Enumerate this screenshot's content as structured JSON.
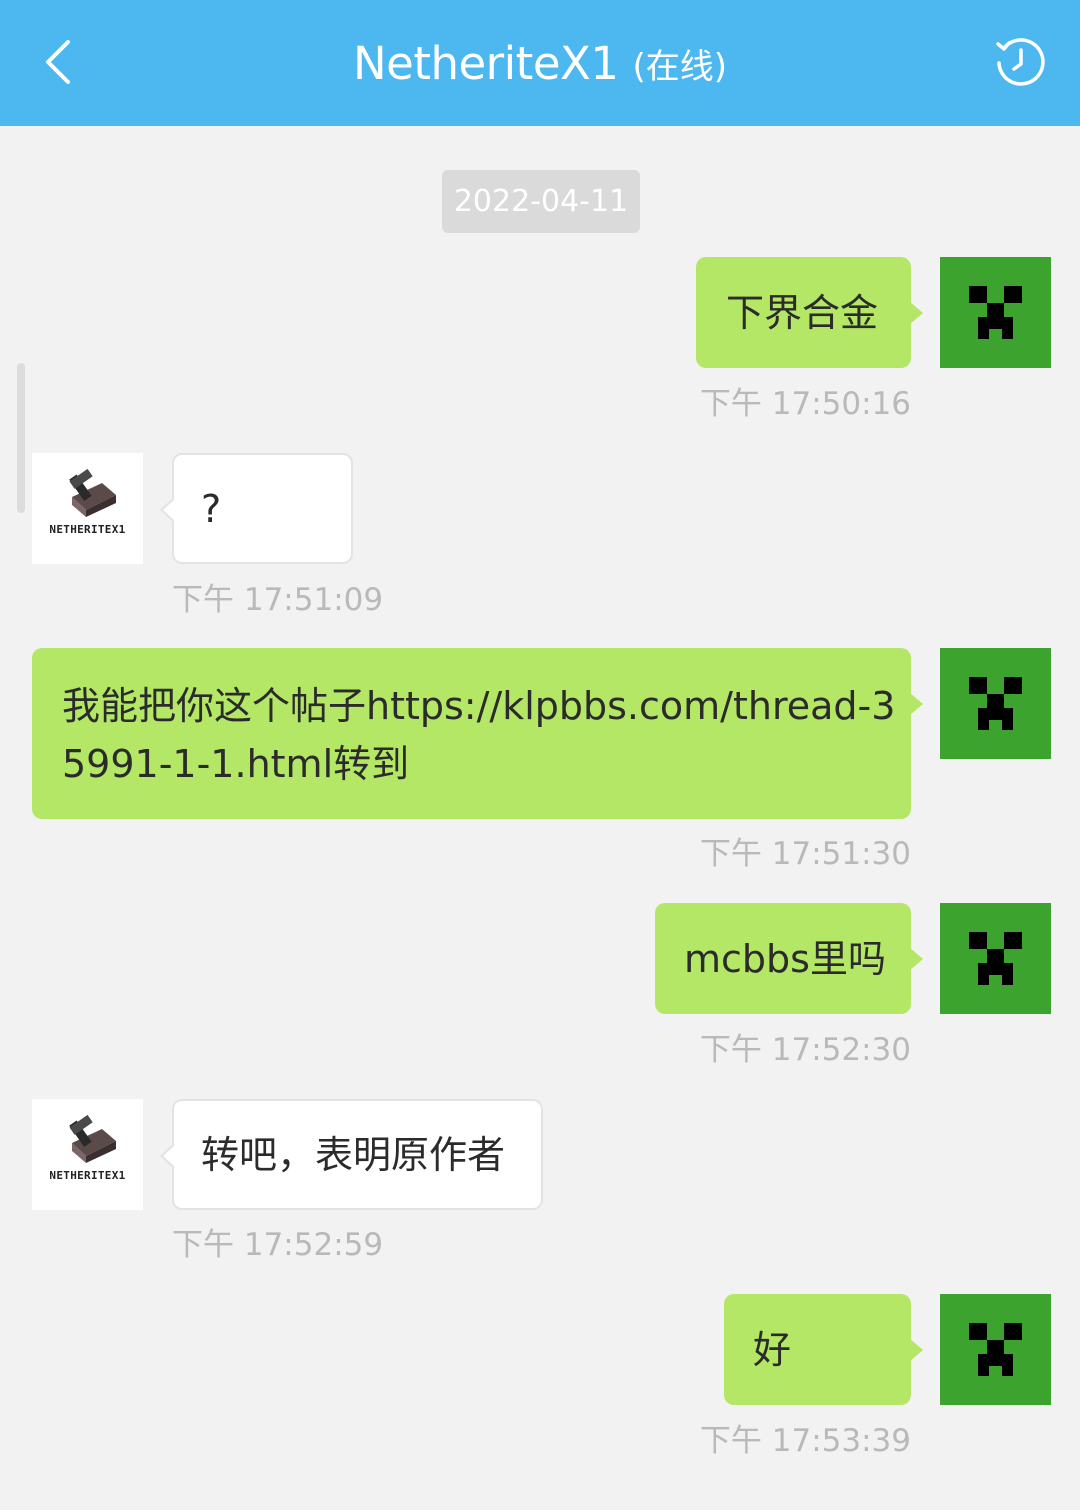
{
  "header": {
    "contact_name": "NetheriteX1",
    "status": "(在线)",
    "back_icon": "chevron-left-icon",
    "history_icon": "history-clock-icon"
  },
  "colors": {
    "header_bg": "#4db8f0",
    "page_bg": "#f2f2f2",
    "my_bubble": "#b3e765",
    "peer_bubble": "#ffffff",
    "my_avatar_bg": "#3ca32f",
    "timestamp": "#b9b9b9"
  },
  "chat": {
    "date_label": "2022-04-11",
    "peer_avatar_logo_text": "NETHERITEX1",
    "messages": [
      {
        "sender": "me",
        "text": "下界合金",
        "time": "下午 17:50:16"
      },
      {
        "sender": "peer",
        "text": "?",
        "time": "下午 17:51:09"
      },
      {
        "sender": "me",
        "text_line1": "我能把你这个帖子https://klpbbs.com/thread-3",
        "text_line2": "5991-1-1.html转到",
        "time": "下午 17:51:30"
      },
      {
        "sender": "me",
        "text": "mcbbs里吗",
        "time": "下午 17:52:30"
      },
      {
        "sender": "peer",
        "text": "转吧，表明原作者",
        "time": "下午 17:52:59"
      },
      {
        "sender": "me",
        "text": "好",
        "time": "下午 17:53:39"
      }
    ]
  }
}
